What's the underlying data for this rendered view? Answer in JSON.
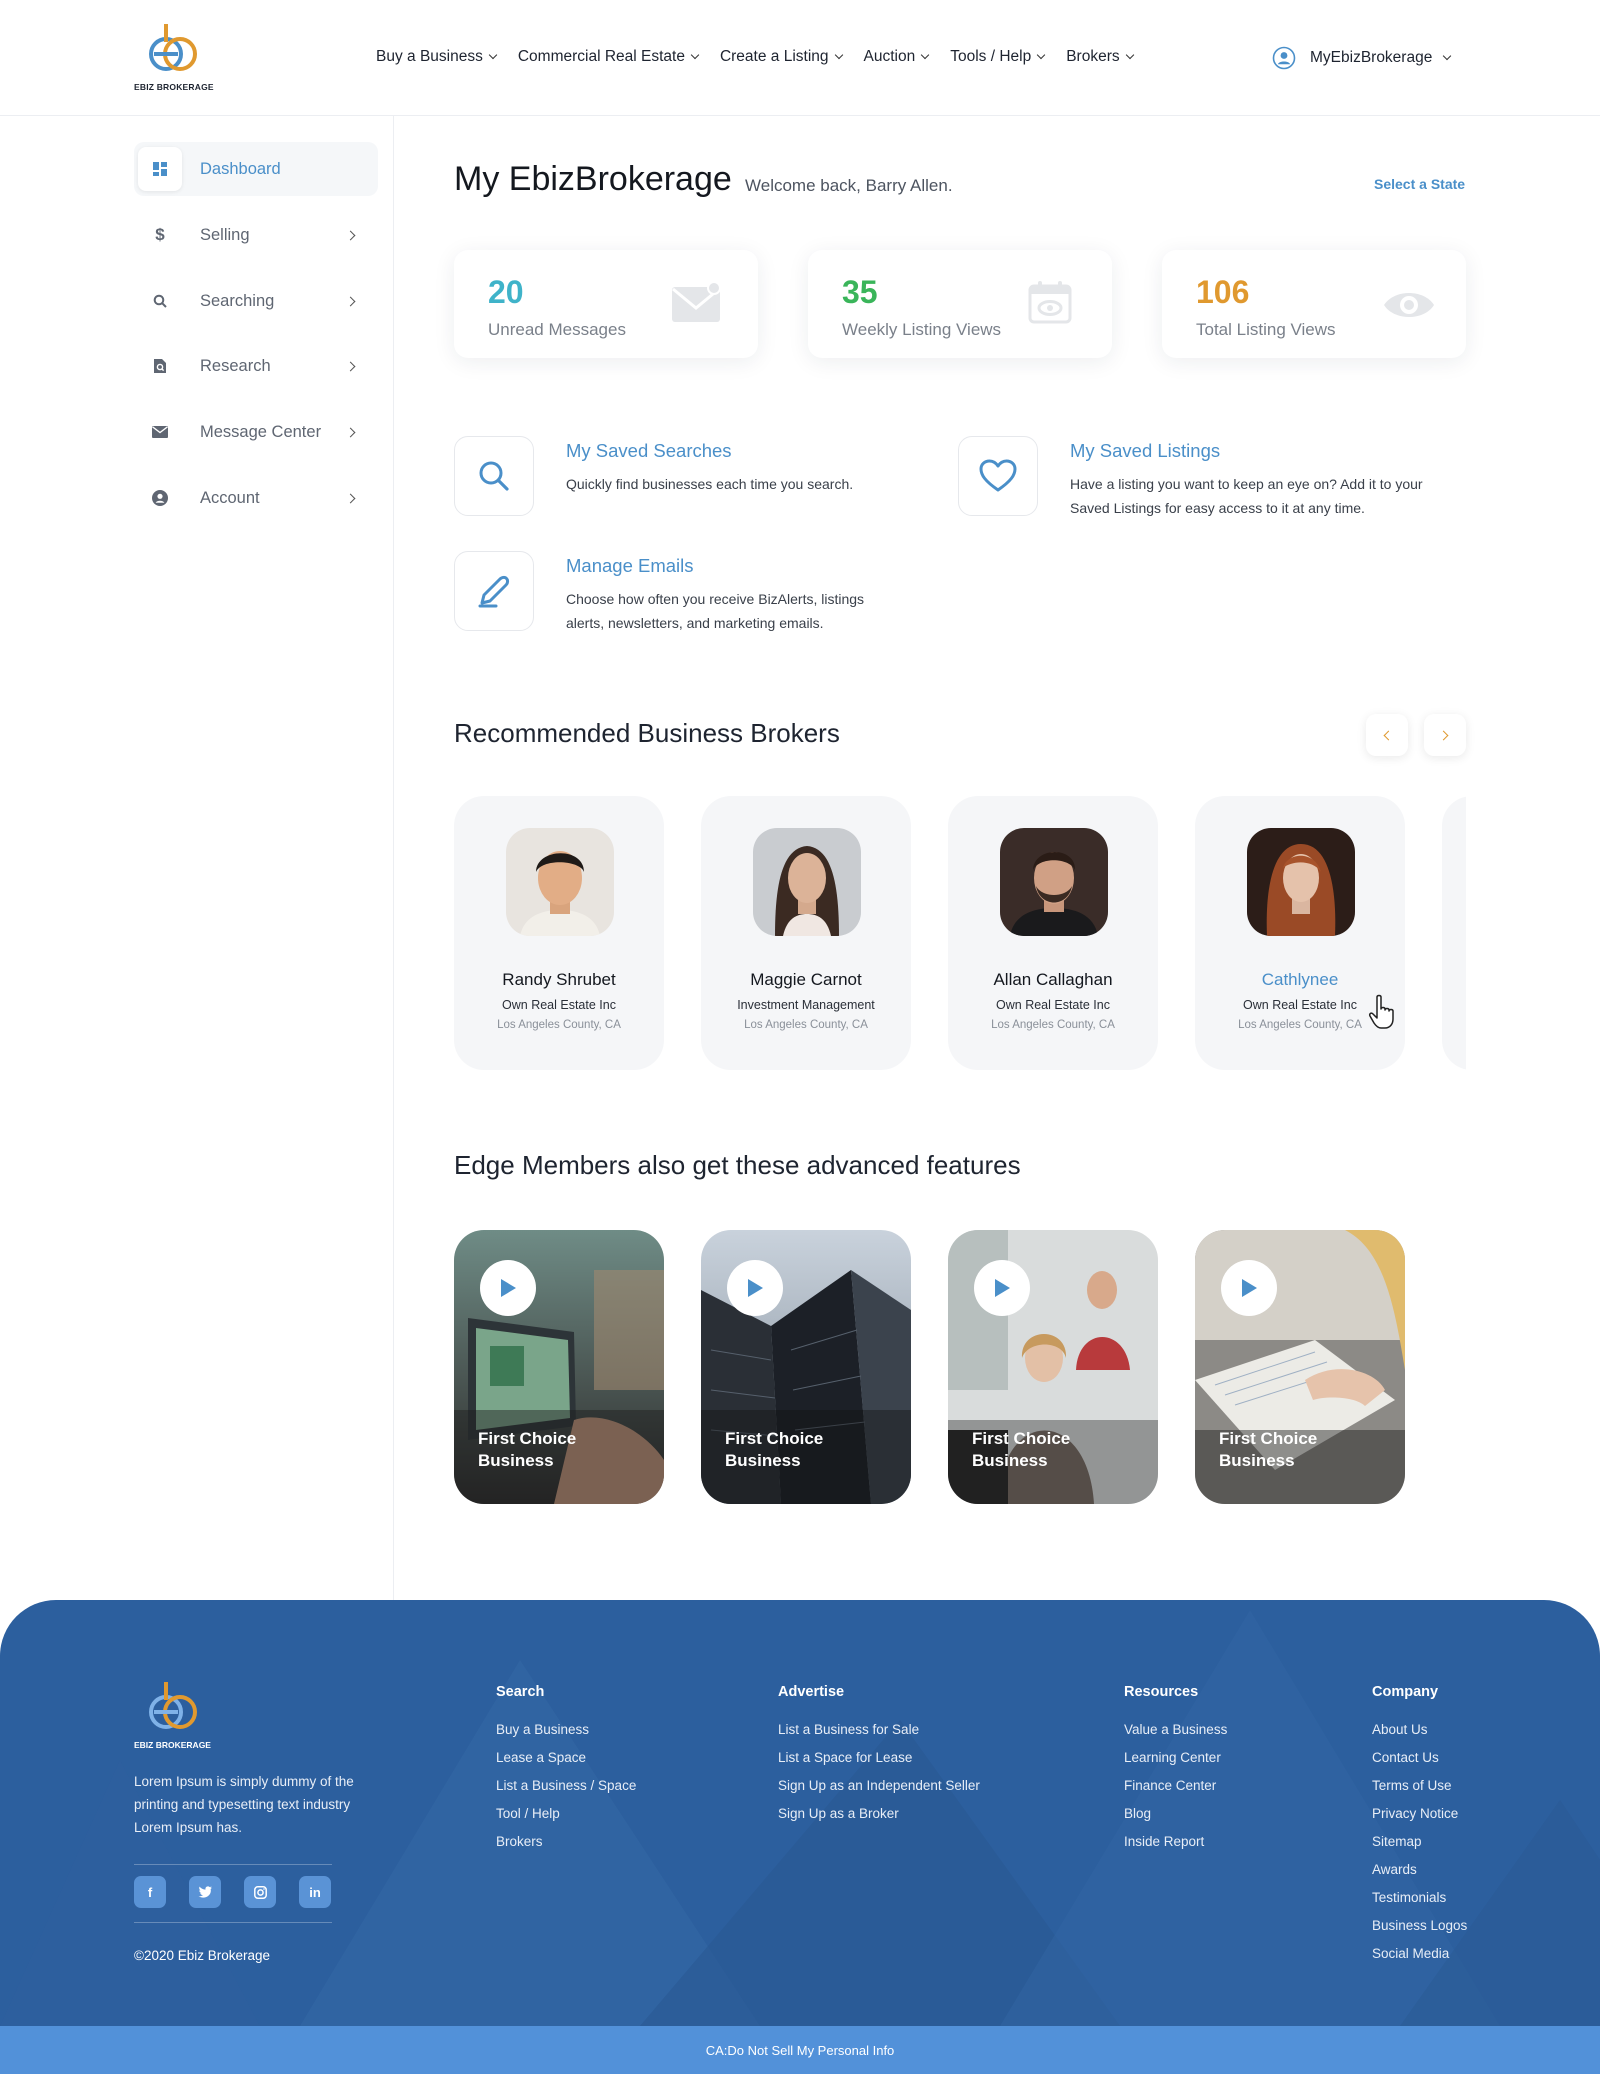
{
  "brand": {
    "logo_text": "EBIZ BROKERAGE",
    "colors": {
      "primary_blue": "#4a8fc9",
      "accent_orange": "#e0992f",
      "footer_blue": "#2c5f9e"
    }
  },
  "nav": {
    "items": [
      {
        "label": "Buy a Business"
      },
      {
        "label": "Commercial Real Estate"
      },
      {
        "label": "Create a Listing"
      },
      {
        "label": "Auction"
      },
      {
        "label": "Tools / Help"
      },
      {
        "label": "Brokers"
      }
    ],
    "user_menu": {
      "label": "MyEbizBrokerage",
      "icon": "user-circle-icon"
    }
  },
  "sidebar": {
    "items": [
      {
        "label": "Dashboard",
        "icon": "dashboard-icon",
        "active": true
      },
      {
        "label": "Selling",
        "icon": "dollar-icon"
      },
      {
        "label": "Searching",
        "icon": "search-icon"
      },
      {
        "label": "Research",
        "icon": "document-search-icon"
      },
      {
        "label": "Message Center",
        "icon": "envelope-icon"
      },
      {
        "label": "Account",
        "icon": "account-icon"
      }
    ]
  },
  "main": {
    "title": "My EbizBrokerage",
    "welcome": "Welcome back, Barry Allen.",
    "select_state": "Select a State",
    "stats": [
      {
        "value": "20",
        "label": "Unread Messages",
        "color": "#3fb3c9",
        "icon": "mail-icon"
      },
      {
        "value": "35",
        "label": "Weekly Listing Views",
        "color": "#3ab55a",
        "icon": "calendar-eye-icon"
      },
      {
        "value": "106",
        "label": "Total Listing Views",
        "color": "#e0992f",
        "icon": "eye-icon"
      }
    ],
    "features": [
      {
        "title": "My Saved Searches",
        "desc": "Quickly find businesses each time you search.",
        "icon": "search-icon"
      },
      {
        "title": "My Saved Listings",
        "desc": "Have a listing you want to keep an eye on? Add it to your Saved Listings for easy access to it at any time.",
        "icon": "heart-icon"
      },
      {
        "title": "Manage Emails",
        "desc": "Choose how often you receive BizAlerts, listings alerts, newsletters, and marketing emails.",
        "icon": "pencil-icon"
      }
    ],
    "brokers_title": "Recommended Business Brokers",
    "brokers": [
      {
        "name": "Randy Shrubet",
        "company": "Own Real Estate Inc",
        "location": "Los Angeles County, CA"
      },
      {
        "name": "Maggie Carnot",
        "company": "Investment Management",
        "location": "Los Angeles County, CA"
      },
      {
        "name": "Allan Callaghan",
        "company": "Own Real Estate Inc",
        "location": "Los Angeles County, CA"
      },
      {
        "name": "Cathlynee",
        "company": "Own Real Estate Inc",
        "location": "Los Angeles County, CA"
      }
    ],
    "features_title": "Edge Members also get these advanced features",
    "videos": [
      {
        "title": "First Choice Business"
      },
      {
        "title": "First Choice Business"
      },
      {
        "title": "First Choice Business"
      },
      {
        "title": "First Choice Business"
      }
    ]
  },
  "footer": {
    "logo_text": "EBIZ BROKERAGE",
    "about": "Lorem Ipsum is simply dummy of the printing and typesetting  text industry Lorem Ipsum has.",
    "socials": [
      {
        "icon": "facebook-icon",
        "glyph": "f"
      },
      {
        "icon": "twitter-icon",
        "glyph": "t"
      },
      {
        "icon": "instagram-icon",
        "glyph": "◎"
      },
      {
        "icon": "linkedin-icon",
        "glyph": "in"
      }
    ],
    "copyright": "©2020 Ebiz Brokerage",
    "columns": [
      {
        "title": "Search",
        "links": [
          "Buy a Business",
          "Lease a Space",
          "List a Business / Space",
          "Tool / Help",
          "Brokers"
        ]
      },
      {
        "title": "Advertise",
        "links": [
          "List a Business for Sale",
          "List a Space for Lease",
          "Sign Up as an Independent Seller",
          "Sign Up as a Broker"
        ]
      },
      {
        "title": "Resources",
        "links": [
          "Value a Business",
          "Learning Center",
          "Finance Center",
          "Blog",
          "Inside Report"
        ]
      },
      {
        "title": "Company",
        "links": [
          "About Us",
          "Contact Us",
          "Terms of Use",
          "Privacy Notice",
          "Sitemap",
          "Awards",
          "Testimonials",
          "Business Logos",
          "Social Media"
        ]
      }
    ],
    "bottom": "CA:Do Not Sell My Personal Info"
  }
}
